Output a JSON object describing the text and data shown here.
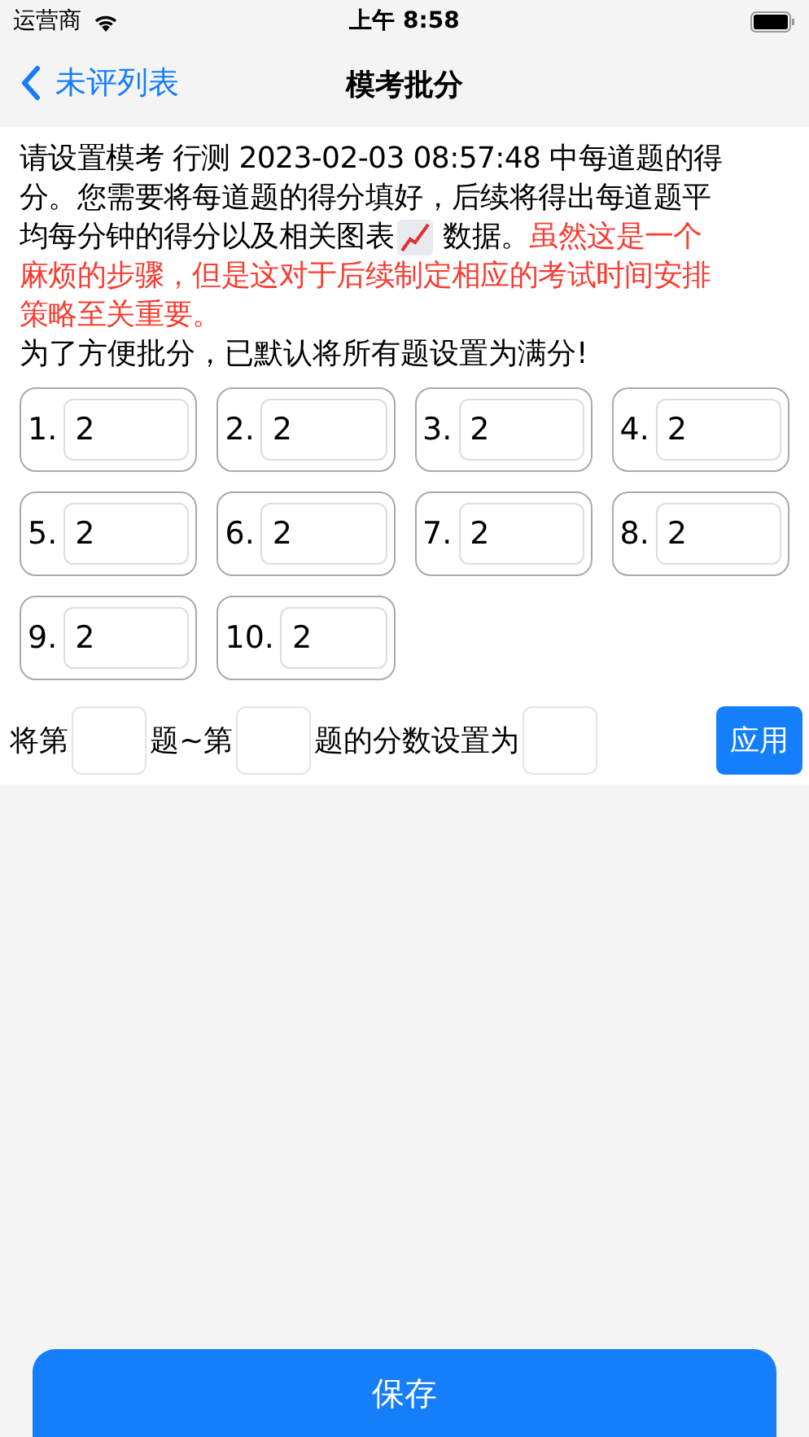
{
  "status_bar": {
    "carrier": "运营商",
    "time": "上午 8:58"
  },
  "nav": {
    "back": "未评列表",
    "title": "模考批分"
  },
  "intro": {
    "lines": [
      [
        {
          "kind": "text",
          "text": "请设置模考 行测 2023-02-03 08:57:48 中每道题的得"
        }
      ],
      [
        {
          "kind": "text",
          "text": "分。您需要将每道题的得分填好，后续将得出每道题平"
        }
      ],
      [
        {
          "kind": "text",
          "text": "均每分钟的得分以及相关图表"
        },
        {
          "kind": "icon"
        },
        {
          "kind": "text",
          "text": "数据。"
        },
        {
          "kind": "warning",
          "text": "虽然这是一个"
        }
      ],
      [
        {
          "kind": "warning",
          "text": "麻烦的步骤，但是这对于后续制定相应的考试时间安排"
        }
      ],
      [
        {
          "kind": "warning",
          "text": "策略至关重要。"
        }
      ]
    ],
    "note": "为了方便批分，已默认将所有题设置为满分!"
  },
  "questions": [
    {
      "label": "1.",
      "value": "2"
    },
    {
      "label": "2.",
      "value": "2"
    },
    {
      "label": "3.",
      "value": "2"
    },
    {
      "label": "4.",
      "value": "2"
    },
    {
      "label": "5.",
      "value": "2"
    },
    {
      "label": "6.",
      "value": "2"
    },
    {
      "label": "7.",
      "value": "2"
    },
    {
      "label": "8.",
      "value": "2"
    },
    {
      "label": "9.",
      "value": "2"
    },
    {
      "label": "10.",
      "value": "2"
    }
  ],
  "range": {
    "prefix": "将第",
    "middle": "题~第",
    "suffix": "题的分数设置为",
    "apply": "应用"
  },
  "save": "保存"
}
